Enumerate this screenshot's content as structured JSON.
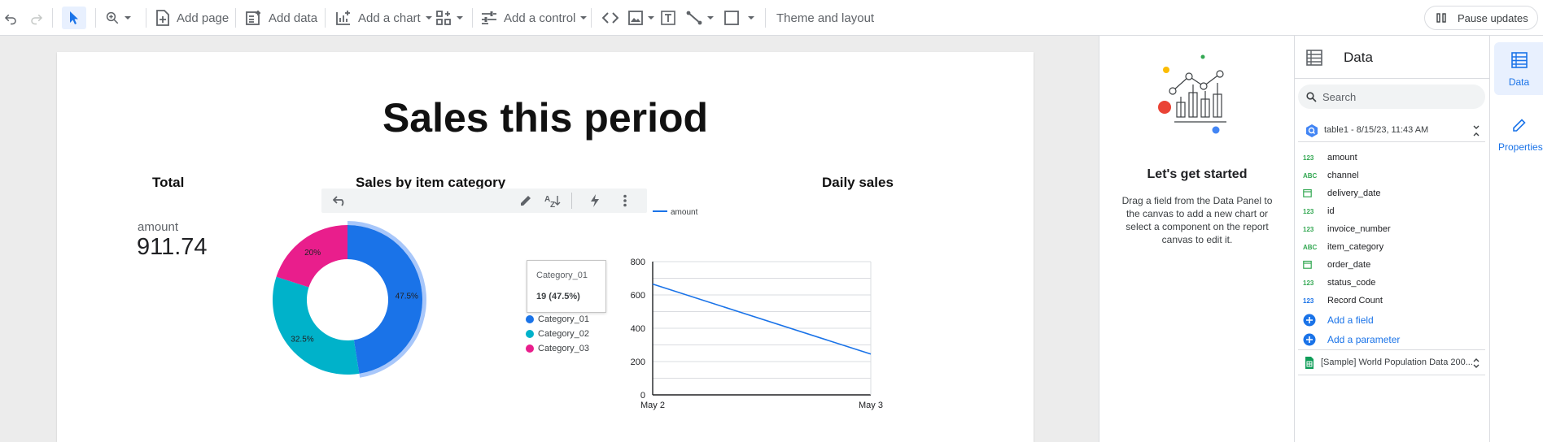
{
  "toolbar": {
    "add_page": "Add page",
    "add_data": "Add data",
    "add_chart": "Add a chart",
    "add_control": "Add a control",
    "theme_layout": "Theme and layout",
    "pause_updates": "Pause updates"
  },
  "report": {
    "title": "Sales this period",
    "scorecard": {
      "title": "Total",
      "metric_label": "amount",
      "value": "911.74"
    },
    "donut": {
      "title": "Sales by item category",
      "tooltip": {
        "name": "Category_01",
        "value": "19 (47.5%)"
      },
      "legend": [
        "Category_01",
        "Category_02",
        "Category_03"
      ],
      "slice_labels": [
        "47.5%",
        "32.5%",
        "20%"
      ]
    },
    "line": {
      "title": "Daily sales",
      "legend": "amount",
      "y_ticks": [
        "800",
        "600",
        "400",
        "200",
        "0"
      ],
      "x_ticks": [
        "May 2",
        "May 3"
      ]
    }
  },
  "chart_data": [
    {
      "type": "pie",
      "title": "Sales by item category",
      "categories": [
        "Category_01",
        "Category_02",
        "Category_03"
      ],
      "values": [
        47.5,
        32.5,
        20
      ],
      "unit": "percent",
      "colors": [
        "#1a73e8",
        "#00b2ca",
        "#e91e8c"
      ],
      "selected": "Category_01",
      "legend_position": "right"
    },
    {
      "type": "line",
      "title": "Daily sales",
      "x": [
        "May 2",
        "May 3"
      ],
      "series": [
        {
          "name": "amount",
          "values": [
            665,
            245
          ]
        }
      ],
      "ylim": [
        0,
        800
      ],
      "y_ticks": [
        0,
        200,
        400,
        600,
        800
      ],
      "grid": true,
      "legend_position": "top-left",
      "color": "#1a73e8"
    }
  ],
  "welcome": {
    "title": "Let's get started",
    "body": "Drag a field from the Data Panel to the canvas to add a new chart or select a component on the report canvas to edit it."
  },
  "data_panel": {
    "title": "Data",
    "search_placeholder": "Search",
    "source": "table1 - 8/15/23, 11:43 AM",
    "fields": [
      {
        "type": "123",
        "name": "amount"
      },
      {
        "type": "ABC",
        "name": "channel"
      },
      {
        "type": "date",
        "name": "delivery_date"
      },
      {
        "type": "123",
        "name": "id"
      },
      {
        "type": "123",
        "name": "invoice_number"
      },
      {
        "type": "ABC",
        "name": "item_category"
      },
      {
        "type": "date",
        "name": "order_date"
      },
      {
        "type": "123",
        "name": "status_code"
      },
      {
        "type": "123",
        "name": "Record Count"
      }
    ],
    "add_field": "Add a field",
    "add_parameter": "Add a parameter",
    "other_source": "[Sample] World Population Data 200..."
  },
  "rail": {
    "data": "Data",
    "properties": "Properties"
  },
  "colors": {
    "accent": "#1a73e8",
    "cat1": "#1a73e8",
    "cat2": "#00b2ca",
    "cat3": "#e91e8c"
  },
  "icons": [
    "undo-icon",
    "redo-icon",
    "cursor-icon",
    "zoom-icon",
    "add-page-icon",
    "add-data-icon",
    "add-chart-icon",
    "community-viz-icon",
    "add-control-icon",
    "code-icon",
    "image-icon",
    "text-icon",
    "line-icon",
    "rectangle-icon",
    "pause-icon",
    "table-icon",
    "search-icon",
    "bigquery-icon",
    "sheets-icon",
    "pencil-icon"
  ]
}
